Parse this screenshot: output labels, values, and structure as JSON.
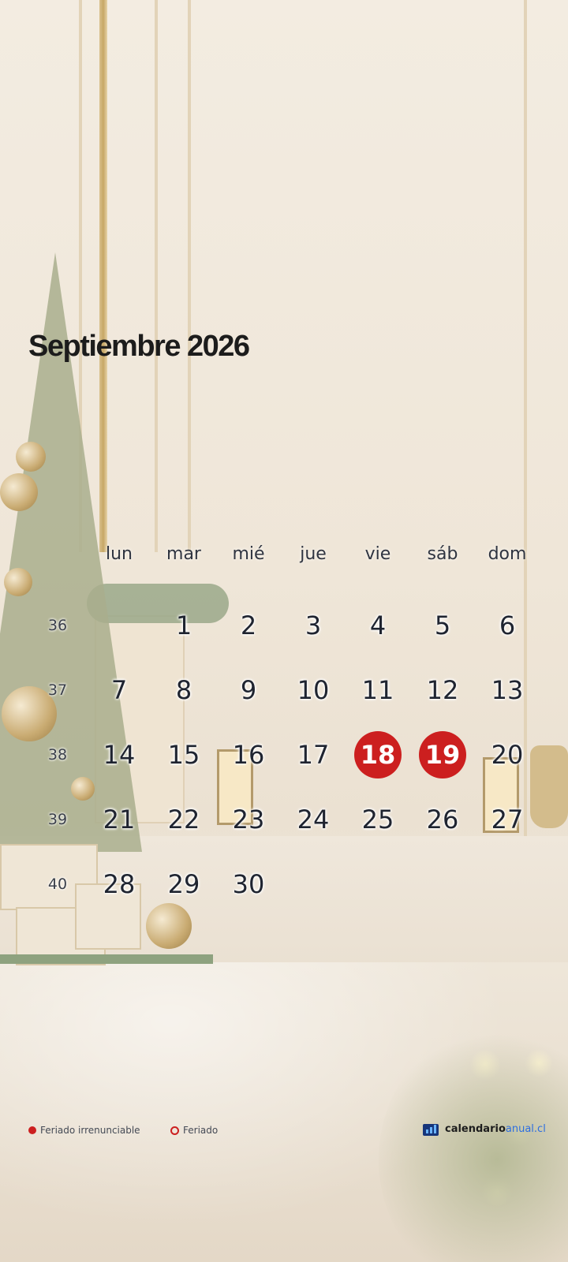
{
  "calendar": {
    "title": "Septiembre 2026",
    "weekdays": [
      "lun",
      "mar",
      "mié",
      "jue",
      "vie",
      "sáb",
      "dom"
    ],
    "weeks": [
      {
        "number": "36",
        "days": [
          "",
          "1",
          "2",
          "3",
          "4",
          "5",
          "6"
        ]
      },
      {
        "number": "37",
        "days": [
          "7",
          "8",
          "9",
          "10",
          "11",
          "12",
          "13"
        ]
      },
      {
        "number": "38",
        "days": [
          "14",
          "15",
          "16",
          "17",
          "18",
          "19",
          "20"
        ]
      },
      {
        "number": "39",
        "days": [
          "21",
          "22",
          "23",
          "24",
          "25",
          "26",
          "27"
        ]
      },
      {
        "number": "40",
        "days": [
          "28",
          "29",
          "30",
          "",
          "",
          "",
          ""
        ]
      }
    ],
    "holidays_irrenunciable": [
      "18",
      "19"
    ],
    "holiday_color": "#cc1f1f"
  },
  "legend": {
    "irrenunciable_label": "Feriado irrenunciable",
    "feriado_label": "Feriado"
  },
  "brand": {
    "icon": "calendar-chart-icon",
    "name_part1": "calendario",
    "name_part2": "anual.cl"
  }
}
